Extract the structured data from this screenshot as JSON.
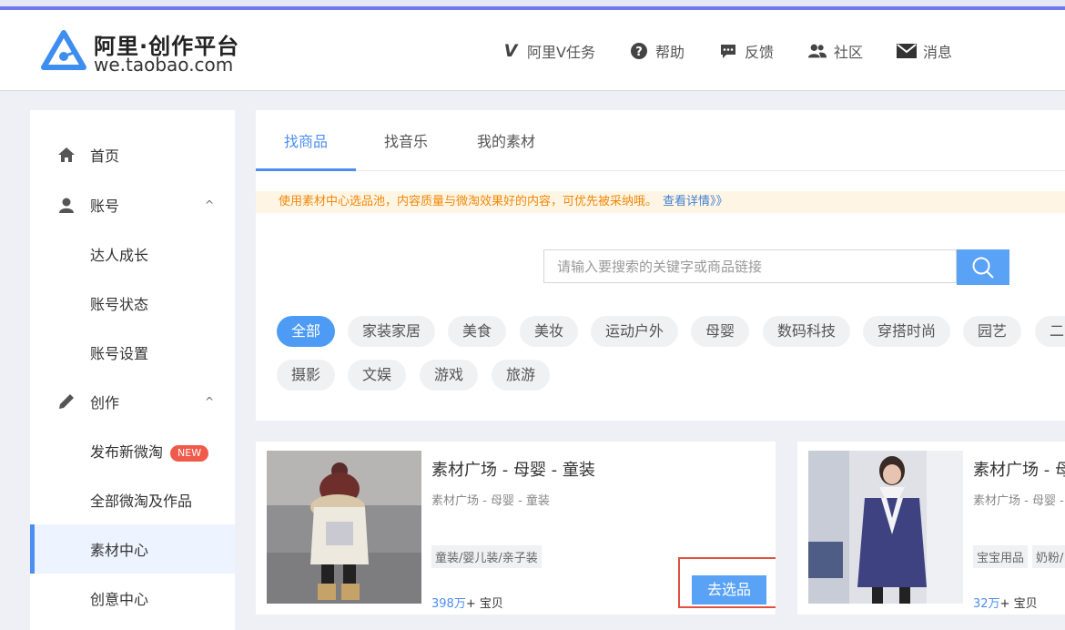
{
  "header": {
    "brand": "阿里·创作平台",
    "domain": "we.taobao.com",
    "nav": [
      {
        "label": "阿里V任务",
        "icon": "v-icon"
      },
      {
        "label": "帮助",
        "icon": "help-icon"
      },
      {
        "label": "反馈",
        "icon": "feedback-icon"
      },
      {
        "label": "社区",
        "icon": "community-icon"
      },
      {
        "label": "消息",
        "icon": "mail-icon"
      }
    ]
  },
  "sidebar": {
    "items": [
      {
        "label": "首页",
        "icon": "home-icon"
      },
      {
        "label": "账号",
        "icon": "user-icon",
        "caret": "^"
      },
      {
        "label": "达人成长"
      },
      {
        "label": "账号状态"
      },
      {
        "label": "账号设置"
      },
      {
        "label": "创作",
        "icon": "pen-icon",
        "caret": "^"
      },
      {
        "label": "发布新微淘",
        "badge": "NEW"
      },
      {
        "label": "全部微淘及作品"
      },
      {
        "label": "素材中心",
        "active": true
      },
      {
        "label": "创意中心"
      }
    ]
  },
  "tabs": [
    {
      "label": "找商品",
      "active": true
    },
    {
      "label": "找音乐"
    },
    {
      "label": "我的素材"
    }
  ],
  "notice": {
    "text": "使用素材中心选品池，内容质量与微淘效果好的内容，可优先被采纳哦。",
    "link": "查看详情》》"
  },
  "search": {
    "placeholder": "请输入要搜索的关键字或商品链接",
    "value": ""
  },
  "categories": [
    "全部",
    "家装家居",
    "美食",
    "美妆",
    "运动户外",
    "母婴",
    "数码科技",
    "穿搭时尚",
    "园艺",
    "二",
    "摄影",
    "文娱",
    "游戏",
    "旅游"
  ],
  "cards": [
    {
      "title": "素材广场 - 母婴 - 童装",
      "crumb": "素材广场 - 母婴 - 童装",
      "tags": [
        "童装/婴儿装/亲子装"
      ],
      "count": "398万",
      "count_suffix": "+ 宝贝",
      "button": "去选品"
    },
    {
      "title": "素材广场 - 母",
      "crumb": "素材广场 - 母婴 -",
      "tags": [
        "宝宝用品",
        "奶粉/"
      ],
      "count": "32万",
      "count_suffix": "+ 宝贝"
    }
  ],
  "colors": {
    "accent": "#4d8ef0",
    "highlight_border": "#e0523d",
    "notice_text": "#f0880a"
  }
}
